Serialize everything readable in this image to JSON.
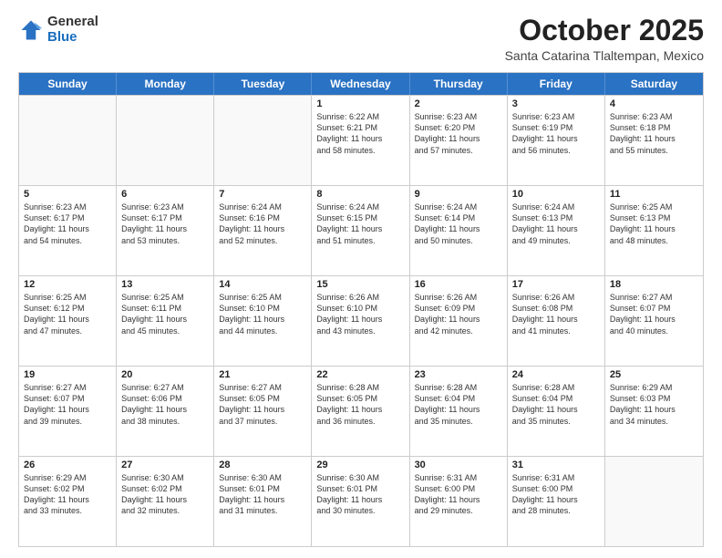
{
  "header": {
    "logo_general": "General",
    "logo_blue": "Blue",
    "month": "October 2025",
    "location": "Santa Catarina Tlaltempan, Mexico"
  },
  "days_of_week": [
    "Sunday",
    "Monday",
    "Tuesday",
    "Wednesday",
    "Thursday",
    "Friday",
    "Saturday"
  ],
  "weeks": [
    [
      {
        "day": "",
        "empty": true
      },
      {
        "day": "",
        "empty": true
      },
      {
        "day": "",
        "empty": true
      },
      {
        "day": "1",
        "sunrise": "6:22 AM",
        "sunset": "6:21 PM",
        "daylight": "11 hours and 58 minutes."
      },
      {
        "day": "2",
        "sunrise": "6:23 AM",
        "sunset": "6:20 PM",
        "daylight": "11 hours and 57 minutes."
      },
      {
        "day": "3",
        "sunrise": "6:23 AM",
        "sunset": "6:19 PM",
        "daylight": "11 hours and 56 minutes."
      },
      {
        "day": "4",
        "sunrise": "6:23 AM",
        "sunset": "6:18 PM",
        "daylight": "11 hours and 55 minutes."
      }
    ],
    [
      {
        "day": "5",
        "sunrise": "6:23 AM",
        "sunset": "6:17 PM",
        "daylight": "11 hours and 54 minutes."
      },
      {
        "day": "6",
        "sunrise": "6:23 AM",
        "sunset": "6:17 PM",
        "daylight": "11 hours and 53 minutes."
      },
      {
        "day": "7",
        "sunrise": "6:24 AM",
        "sunset": "6:16 PM",
        "daylight": "11 hours and 52 minutes."
      },
      {
        "day": "8",
        "sunrise": "6:24 AM",
        "sunset": "6:15 PM",
        "daylight": "11 hours and 51 minutes."
      },
      {
        "day": "9",
        "sunrise": "6:24 AM",
        "sunset": "6:14 PM",
        "daylight": "11 hours and 50 minutes."
      },
      {
        "day": "10",
        "sunrise": "6:24 AM",
        "sunset": "6:13 PM",
        "daylight": "11 hours and 49 minutes."
      },
      {
        "day": "11",
        "sunrise": "6:25 AM",
        "sunset": "6:13 PM",
        "daylight": "11 hours and 48 minutes."
      }
    ],
    [
      {
        "day": "12",
        "sunrise": "6:25 AM",
        "sunset": "6:12 PM",
        "daylight": "11 hours and 47 minutes."
      },
      {
        "day": "13",
        "sunrise": "6:25 AM",
        "sunset": "6:11 PM",
        "daylight": "11 hours and 45 minutes."
      },
      {
        "day": "14",
        "sunrise": "6:25 AM",
        "sunset": "6:10 PM",
        "daylight": "11 hours and 44 minutes."
      },
      {
        "day": "15",
        "sunrise": "6:26 AM",
        "sunset": "6:10 PM",
        "daylight": "11 hours and 43 minutes."
      },
      {
        "day": "16",
        "sunrise": "6:26 AM",
        "sunset": "6:09 PM",
        "daylight": "11 hours and 42 minutes."
      },
      {
        "day": "17",
        "sunrise": "6:26 AM",
        "sunset": "6:08 PM",
        "daylight": "11 hours and 41 minutes."
      },
      {
        "day": "18",
        "sunrise": "6:27 AM",
        "sunset": "6:07 PM",
        "daylight": "11 hours and 40 minutes."
      }
    ],
    [
      {
        "day": "19",
        "sunrise": "6:27 AM",
        "sunset": "6:07 PM",
        "daylight": "11 hours and 39 minutes."
      },
      {
        "day": "20",
        "sunrise": "6:27 AM",
        "sunset": "6:06 PM",
        "daylight": "11 hours and 38 minutes."
      },
      {
        "day": "21",
        "sunrise": "6:27 AM",
        "sunset": "6:05 PM",
        "daylight": "11 hours and 37 minutes."
      },
      {
        "day": "22",
        "sunrise": "6:28 AM",
        "sunset": "6:05 PM",
        "daylight": "11 hours and 36 minutes."
      },
      {
        "day": "23",
        "sunrise": "6:28 AM",
        "sunset": "6:04 PM",
        "daylight": "11 hours and 35 minutes."
      },
      {
        "day": "24",
        "sunrise": "6:28 AM",
        "sunset": "6:04 PM",
        "daylight": "11 hours and 35 minutes."
      },
      {
        "day": "25",
        "sunrise": "6:29 AM",
        "sunset": "6:03 PM",
        "daylight": "11 hours and 34 minutes."
      }
    ],
    [
      {
        "day": "26",
        "sunrise": "6:29 AM",
        "sunset": "6:02 PM",
        "daylight": "11 hours and 33 minutes."
      },
      {
        "day": "27",
        "sunrise": "6:30 AM",
        "sunset": "6:02 PM",
        "daylight": "11 hours and 32 minutes."
      },
      {
        "day": "28",
        "sunrise": "6:30 AM",
        "sunset": "6:01 PM",
        "daylight": "11 hours and 31 minutes."
      },
      {
        "day": "29",
        "sunrise": "6:30 AM",
        "sunset": "6:01 PM",
        "daylight": "11 hours and 30 minutes."
      },
      {
        "day": "30",
        "sunrise": "6:31 AM",
        "sunset": "6:00 PM",
        "daylight": "11 hours and 29 minutes."
      },
      {
        "day": "31",
        "sunrise": "6:31 AM",
        "sunset": "6:00 PM",
        "daylight": "11 hours and 28 minutes."
      },
      {
        "day": "",
        "empty": true
      }
    ]
  ],
  "labels": {
    "sunrise": "Sunrise:",
    "sunset": "Sunset:",
    "daylight": "Daylight:"
  }
}
